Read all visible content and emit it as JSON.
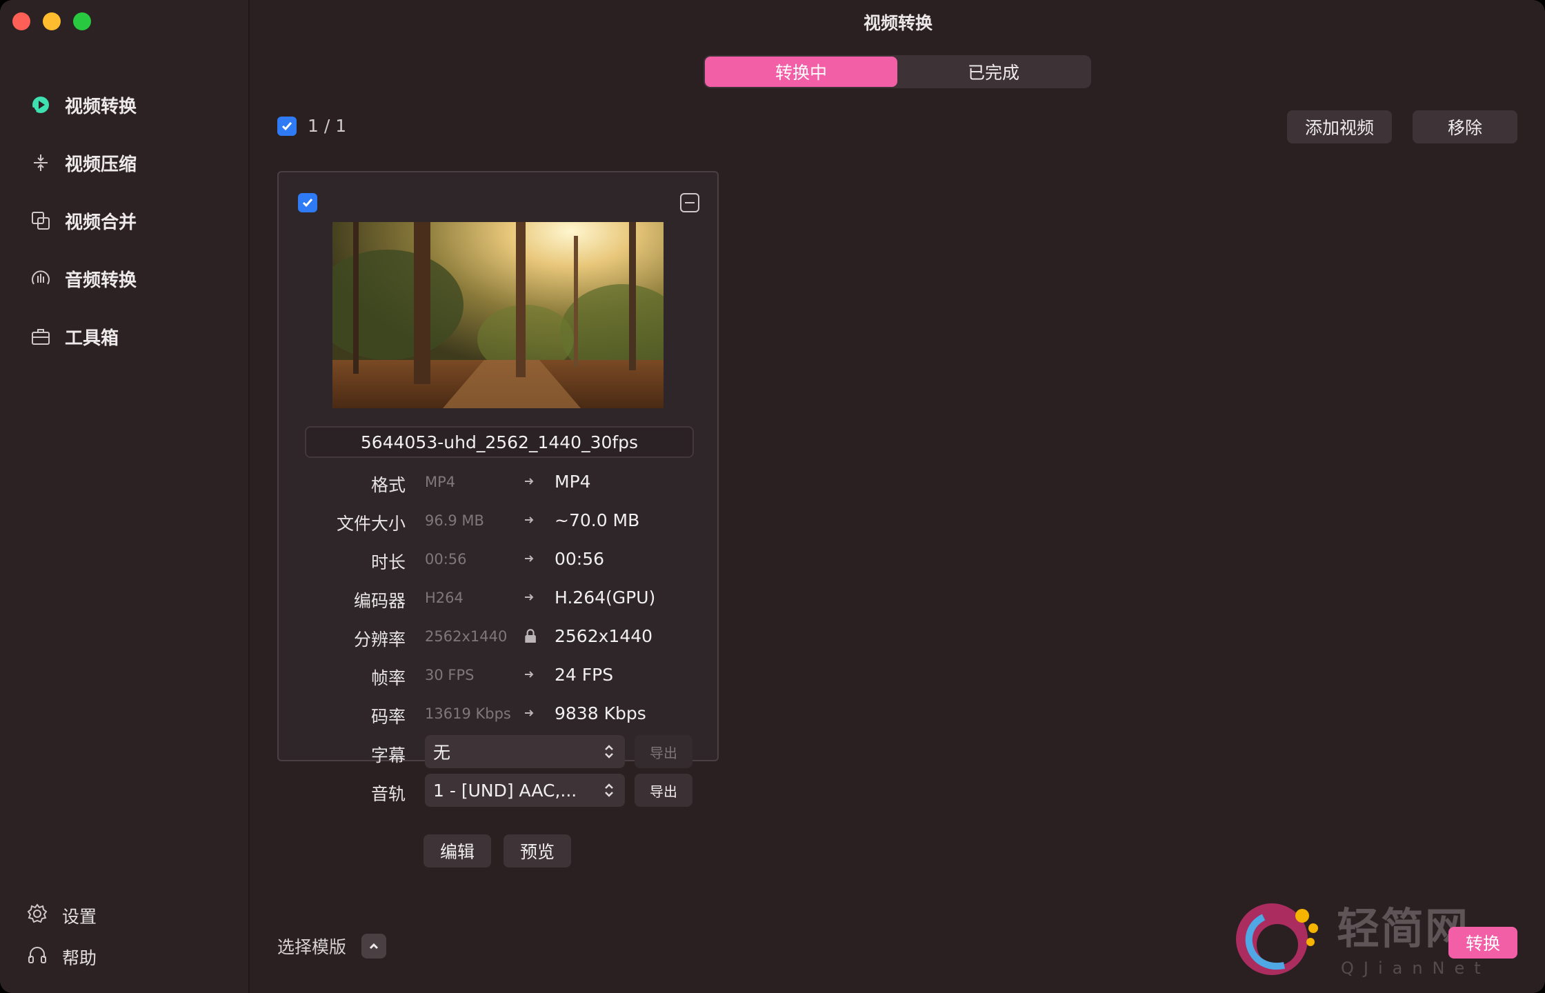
{
  "window": {
    "title": "视频转换"
  },
  "sidebar": {
    "items": [
      {
        "label": "视频转换",
        "icon": "video-convert-icon",
        "active": true
      },
      {
        "label": "视频压缩",
        "icon": "compress-icon"
      },
      {
        "label": "视频合并",
        "icon": "merge-icon"
      },
      {
        "label": "音频转换",
        "icon": "audio-wave-icon"
      },
      {
        "label": "工具箱",
        "icon": "toolbox-icon"
      }
    ],
    "bottom": [
      {
        "label": "设置",
        "icon": "gear-icon"
      },
      {
        "label": "帮助",
        "icon": "headset-icon"
      }
    ]
  },
  "tabs": [
    {
      "label": "转换中",
      "active": true
    },
    {
      "label": "已完成",
      "active": false
    }
  ],
  "toolbar": {
    "count": "1 / 1",
    "add_video": "添加视频",
    "remove": "移除"
  },
  "card": {
    "filename": "5644053-uhd_2562_1440_30fps",
    "properties": [
      {
        "label": "格式",
        "original": "MP4",
        "converted": "MP4",
        "locked": false
      },
      {
        "label": "文件大小",
        "original": "96.9 MB",
        "converted": "~70.0 MB",
        "locked": false
      },
      {
        "label": "时长",
        "original": "00:56",
        "converted": "00:56",
        "locked": false
      },
      {
        "label": "编码器",
        "original": "H264",
        "converted": "H.264(GPU)",
        "locked": false
      },
      {
        "label": "分辨率",
        "original": "2562x1440",
        "converted": "2562x1440",
        "locked": true
      },
      {
        "label": "帧率",
        "original": "30 FPS",
        "converted": "24 FPS",
        "locked": false
      },
      {
        "label": "码率",
        "original": "13619 Kbps",
        "converted": "9838 Kbps",
        "locked": false
      }
    ],
    "subtitle": {
      "label": "字幕",
      "value": "无",
      "export": "导出"
    },
    "audio": {
      "label": "音轨",
      "value": "1 - [UND] AAC,...",
      "export": "导出"
    },
    "edit": "编辑",
    "preview": "预览"
  },
  "template_label": "选择模版",
  "convert_label": "转换",
  "watermark": {
    "text": "轻简网",
    "sub": "QJianNet"
  },
  "colors": {
    "accent": "#f25fa6",
    "checkbox": "#2f7bf6",
    "background": "#2a2022"
  }
}
